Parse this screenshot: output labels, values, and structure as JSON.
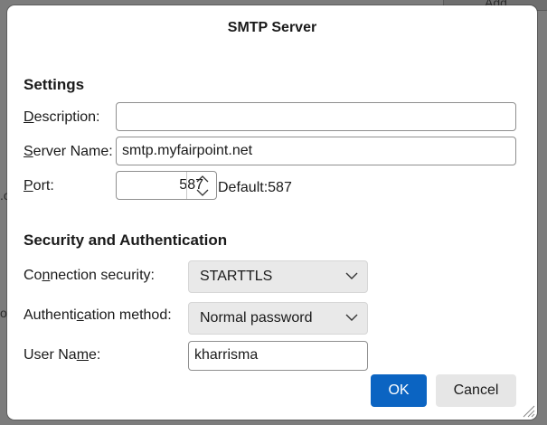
{
  "background": {
    "add_button_label": "Add",
    "fragments": [
      ".o",
      "o"
    ]
  },
  "dialog": {
    "title": "SMTP Server",
    "settings": {
      "heading": "Settings",
      "description": {
        "label_accel": "D",
        "label_rest": "escription:",
        "value": ""
      },
      "server_name": {
        "label_accel": "S",
        "label_rest": "erver Name:",
        "value": "smtp.myfairpoint.net"
      },
      "port": {
        "label_accel": "P",
        "label_rest": "ort:",
        "value": "587",
        "default_text": "Default:587"
      }
    },
    "security": {
      "heading": "Security and Authentication",
      "connection_security": {
        "label_pre": "Co",
        "label_accel": "n",
        "label_rest": "nection security:",
        "selected": "STARTTLS"
      },
      "auth_method": {
        "label_pre": "Authenti",
        "label_accel": "c",
        "label_rest": "ation method:",
        "selected": "Normal password"
      },
      "user_name": {
        "label_pre": "User Na",
        "label_accel": "m",
        "label_rest": "e:",
        "value": "kharrisma"
      }
    },
    "buttons": {
      "ok": "OK",
      "cancel": "Cancel"
    }
  },
  "icons": {
    "spinner_up": "chevron-up-icon",
    "spinner_down": "chevron-down-icon",
    "select_arrow": "chevron-down-icon",
    "resize": "resize-grip-icon"
  },
  "colors": {
    "primary": "#0b64c2",
    "dialog_bg": "#ffffff",
    "select_bg": "#e9e9e9"
  }
}
